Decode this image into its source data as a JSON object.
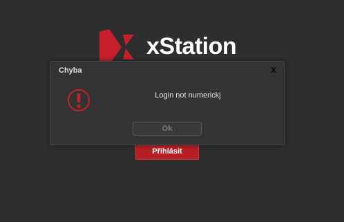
{
  "brand": {
    "name": "xStation",
    "logo_icon": "xstation-logo-icon",
    "logo_color": "#c8202a"
  },
  "login": {
    "button_label": "Přihlásit"
  },
  "dialog": {
    "title": "Chyba",
    "close_label": "x",
    "message": "Login not numerickj",
    "ok_label": "Ok",
    "icon": "exclamation-circle-icon",
    "icon_color": "#c8202a"
  }
}
